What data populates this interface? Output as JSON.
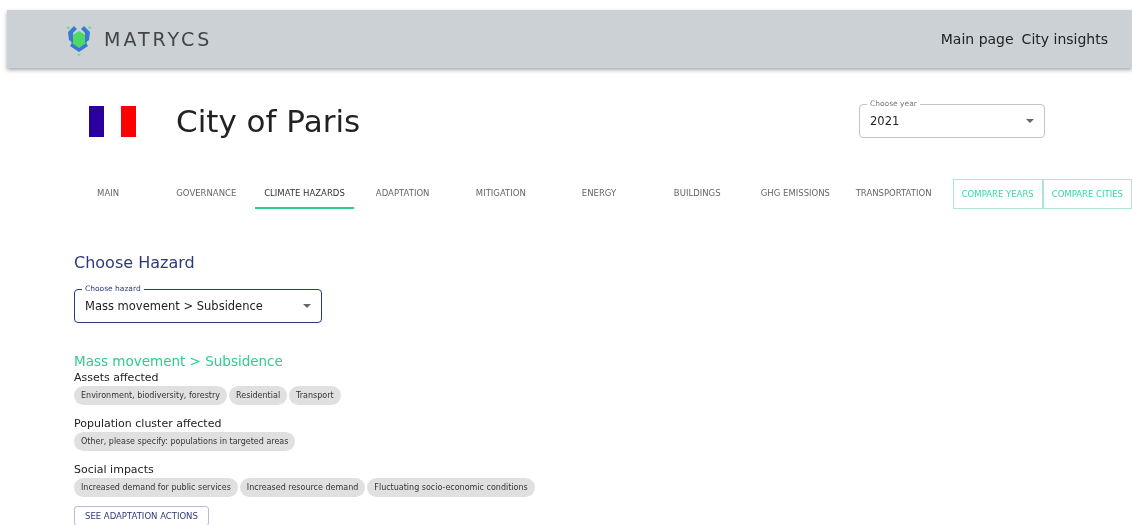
{
  "header": {
    "brand": "MATRYCS",
    "nav": [
      "Main page",
      "City insights"
    ]
  },
  "city": {
    "title": "City of Paris"
  },
  "year_select": {
    "label": "Choose year",
    "value": "2021"
  },
  "tabs": [
    {
      "label": "MAIN",
      "kind": "tab",
      "selected": false
    },
    {
      "label": "GOVERNANCE",
      "kind": "tab",
      "selected": false
    },
    {
      "label": "CLIMATE HAZARDS",
      "kind": "tab",
      "selected": true
    },
    {
      "label": "ADAPTATION",
      "kind": "tab",
      "selected": false
    },
    {
      "label": "MITIGATION",
      "kind": "tab",
      "selected": false
    },
    {
      "label": "ENERGY",
      "kind": "tab",
      "selected": false
    },
    {
      "label": "BUILDINGS",
      "kind": "tab",
      "selected": false
    },
    {
      "label": "GHG EMISSIONS",
      "kind": "tab",
      "selected": false
    },
    {
      "label": "TRANSPORTATION",
      "kind": "tab",
      "selected": false
    },
    {
      "label": "COMPARE YEARS",
      "kind": "outlined",
      "selected": false
    },
    {
      "label": "COMPARE CITIES",
      "kind": "outlined",
      "selected": false
    }
  ],
  "hazard_section": {
    "title": "Choose Hazard",
    "select": {
      "label": "Choose hazard",
      "value": "Mass movement > Subsidence"
    }
  },
  "hazard": {
    "title": "Mass movement > Subsidence",
    "groups": [
      {
        "label": "Assets affected",
        "chips": [
          "Environment, biodiversity, forestry",
          "Residential",
          "Transport"
        ]
      },
      {
        "label": "Population cluster affected",
        "chips": [
          "Other, please specify: populations in targeted areas"
        ]
      },
      {
        "label": "Social impacts",
        "chips": [
          "Increased demand for public services",
          "Increased resource demand",
          "Fluctuating socio-economic conditions"
        ]
      }
    ],
    "action": "SEE ADAPTATION ACTIONS"
  }
}
